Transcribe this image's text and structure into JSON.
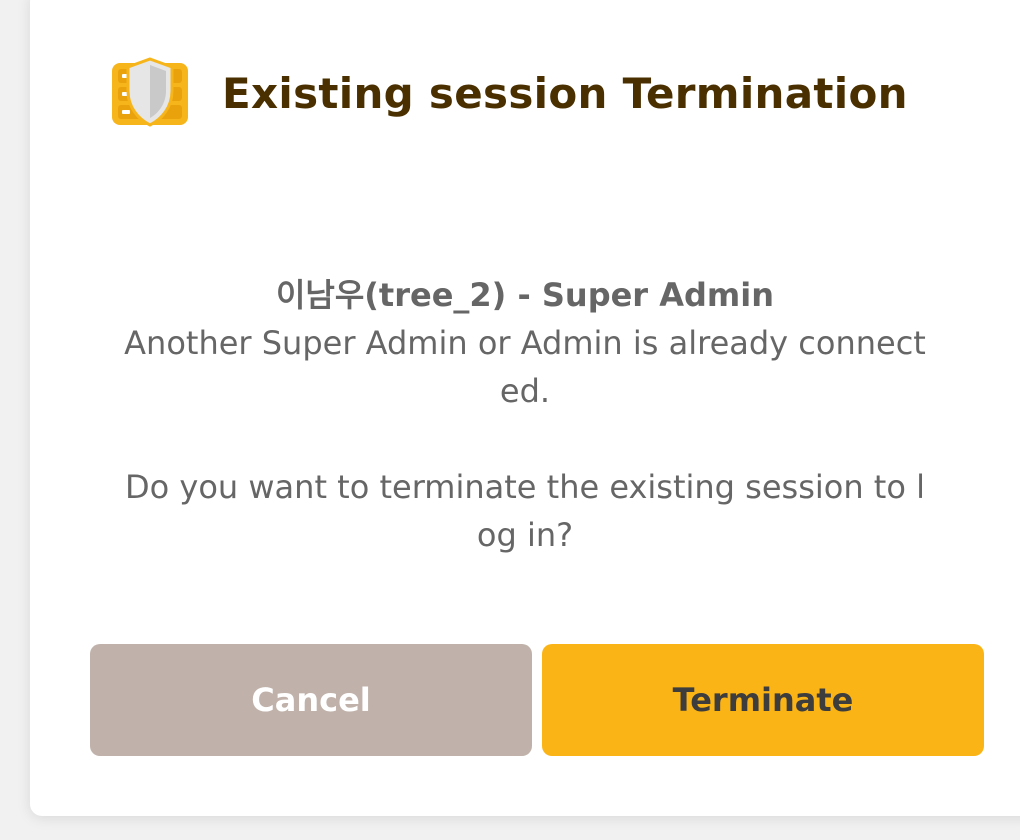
{
  "dialog": {
    "title": "Existing session Termination",
    "logo_icon": "server-shield-icon",
    "user_line": "이남우(tree_2) - Super Admin",
    "message_line1": "Another Super Admin or Admin is already connect",
    "message_line2": "ed.",
    "question_line1": "Do you want to terminate the existing session to l",
    "question_line2": "og in?",
    "buttons": {
      "cancel_label": "Cancel",
      "terminate_label": "Terminate"
    }
  },
  "colors": {
    "accent": "#fbb416",
    "title": "#4a3000",
    "cancel": "#c0b2aa",
    "text": "#666666"
  }
}
